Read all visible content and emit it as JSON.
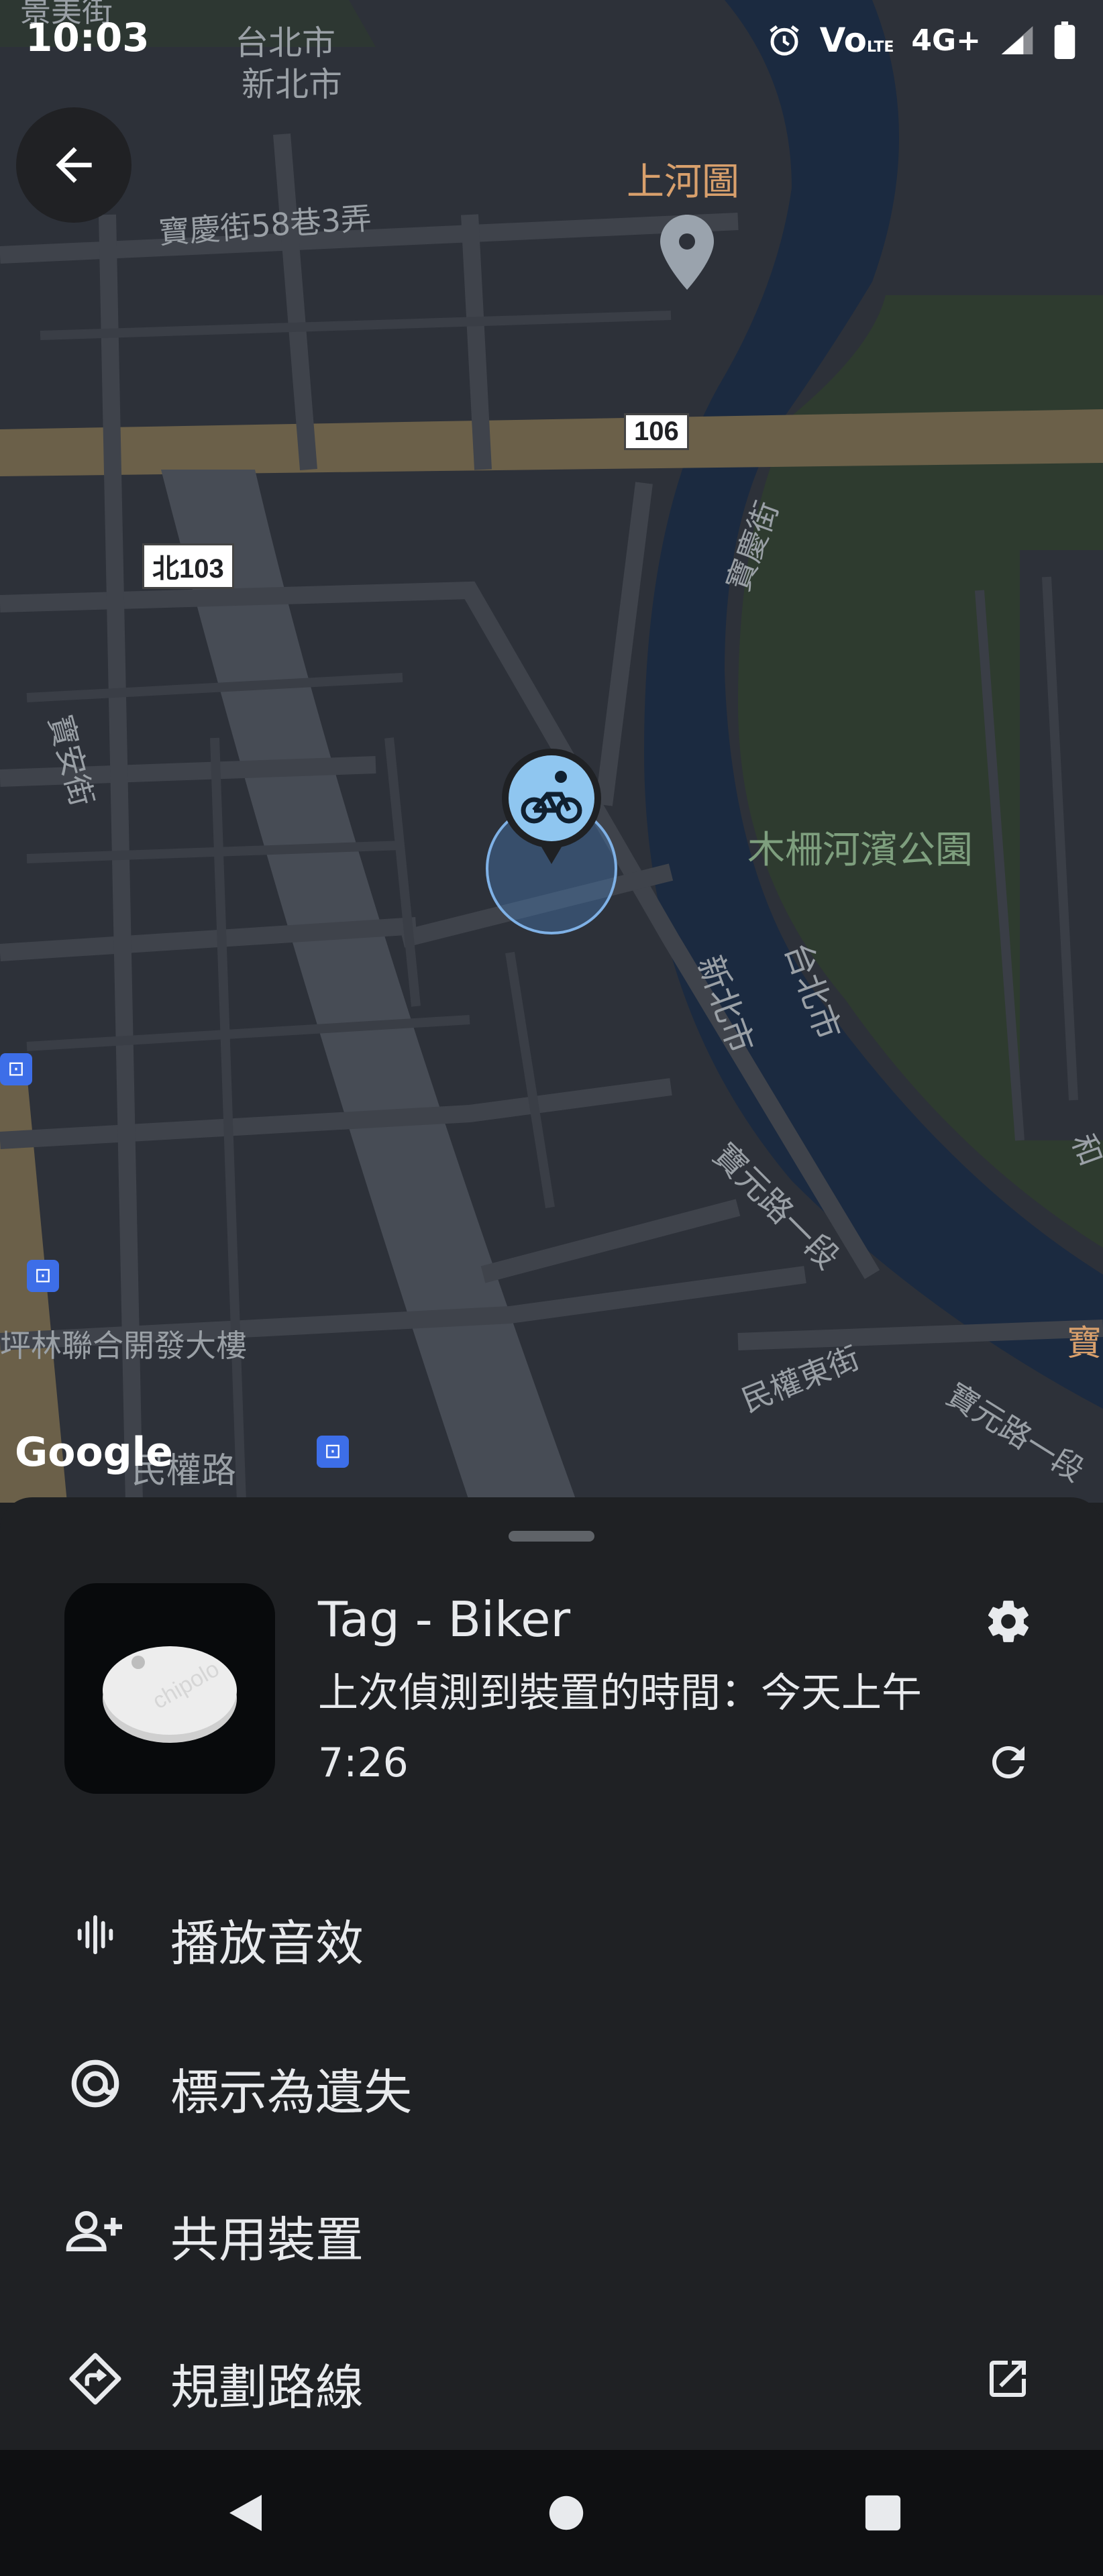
{
  "status_bar": {
    "time": "10:03",
    "alarm_icon": "alarm-icon",
    "volte_text": "Vo",
    "lte_text": "LTE",
    "network_text": "4G+",
    "signal_icon": "signal-icon",
    "battery_icon": "battery-icon"
  },
  "map": {
    "labels": {
      "district_top_1": "台北市",
      "district_top_2": "新北市",
      "place_poi": "上河圖",
      "street_baoqing_lane": "寶慶街58巷3弄",
      "route_106": "106",
      "route_north103": "北103",
      "street_baoqing": "寶慶街",
      "street_baoan": "寶安街",
      "park": "木柵河濱公園",
      "district_mid_1": "新北市",
      "district_mid_2": "台北市",
      "street_baoyuan": "寶元路一段",
      "building": "坪林聯合開發大樓",
      "street_minquan_east": "民權東街",
      "street_baoyuan_2": "寶元路一段",
      "street_minquan": "民權路",
      "edge_bao": "寶",
      "edge_he": "和",
      "street_top": "景美街",
      "google_logo": "Google"
    },
    "device_marker_icon": "bicycle-icon"
  },
  "back_button": {
    "icon": "arrow-left-icon"
  },
  "device": {
    "name": "Tag - Biker",
    "last_seen": "上次偵測到裝置的時間：今天上午7:26",
    "settings_icon": "gear-icon",
    "refresh_icon": "refresh-icon",
    "thumb_brand_text": "chipolo"
  },
  "actions": [
    {
      "label": "播放音效",
      "icon": "sound-wave-icon"
    },
    {
      "label": "標示為遺失",
      "icon": "at-sign-icon"
    },
    {
      "label": "共用裝置",
      "icon": "add-person-icon"
    },
    {
      "label": "規劃路線",
      "icon": "directions-icon",
      "external_icon": "open-external-icon"
    }
  ],
  "nav_bar": {
    "back_icon": "nav-back-icon",
    "home_icon": "nav-home-icon",
    "recents_icon": "nav-recents-icon"
  }
}
